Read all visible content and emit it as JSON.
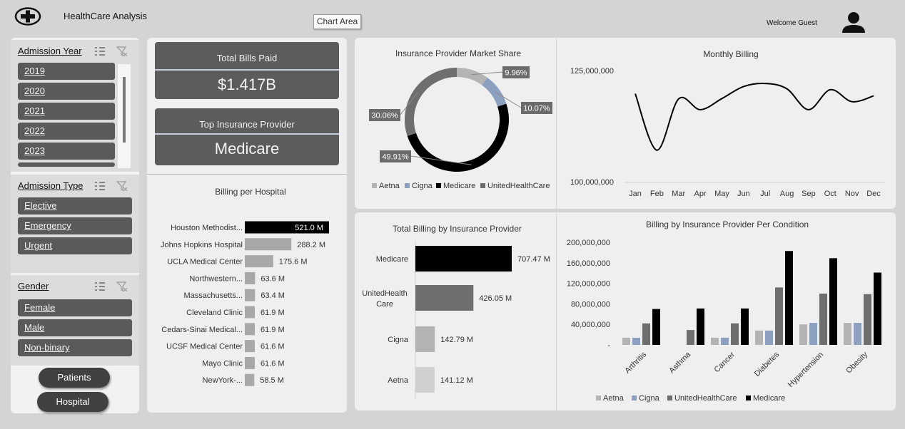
{
  "header": {
    "title": "HealthCare Analysis",
    "welcome": "Welcome Guest",
    "tooltip": "Chart Area"
  },
  "slicers": {
    "admission_year": {
      "title": "Admission Year",
      "items": [
        "2019",
        "2020",
        "2021",
        "2022",
        "2023"
      ]
    },
    "admission_type": {
      "title": "Admission Type",
      "items": [
        "Elective",
        "Emergency",
        "Urgent"
      ]
    },
    "gender": {
      "title": "Gender",
      "items": [
        "Female",
        "Male",
        "Non-binary"
      ]
    }
  },
  "nav": {
    "patients": "Patients",
    "hospital": "Hospital"
  },
  "kpis": {
    "total_bills_label": "Total Bills Paid",
    "total_bills_value": "$1.417B",
    "top_provider_label": "Top Insurance Provider",
    "top_provider_value": "Medicare"
  },
  "colors": {
    "aetna": "#b4b4b4",
    "cigna": "#8da0c0",
    "medicare": "#000000",
    "unitedhealthcare": "#6e6e6e"
  },
  "chart_data": [
    {
      "type": "bar",
      "title": "Billing per Hospital",
      "orientation": "horizontal",
      "categories": [
        "Houston Methodist...",
        "Johns Hopkins Hospital",
        "UCLA Medical Center",
        "Northwestern...",
        "Massachusetts...",
        "Cleveland Clinic",
        "Cedars-Sinai Medical...",
        "UCSF Medical Center",
        "Mayo Clinic",
        "NewYork-..."
      ],
      "values": [
        521.0,
        288.2,
        175.6,
        63.6,
        63.4,
        61.9,
        61.9,
        61.6,
        61.6,
        58.5
      ],
      "labels": [
        "521.0 M",
        "288.2 M",
        "175.6 M",
        "63.6 M",
        "63.4 M",
        "61.9 M",
        "61.9 M",
        "61.6 M",
        "61.6 M",
        "58.5 M"
      ]
    },
    {
      "type": "pie",
      "title": "Insurance Provider Market Share",
      "categories": [
        "Aetna",
        "Cigna",
        "Medicare",
        "UnitedHealthCare"
      ],
      "values": [
        9.96,
        10.07,
        49.91,
        30.06
      ],
      "labels": [
        "9.96%",
        "10.07%",
        "49.91%",
        "30.06%"
      ]
    },
    {
      "type": "line",
      "title": "Monthly Billing",
      "categories": [
        "Jan",
        "Feb",
        "Mar",
        "Apr",
        "May",
        "Jun",
        "Jul",
        "Aug",
        "Sep",
        "Oct",
        "Nov",
        "Dec"
      ],
      "values": [
        119800000,
        107100000,
        118600000,
        116200000,
        118700000,
        121400000,
        122100000,
        120900000,
        116200000,
        120700000,
        118000000,
        119300000
      ],
      "ylim": [
        100000000,
        125000000
      ],
      "yticks": [
        "125,000,000",
        "100,000,000"
      ]
    },
    {
      "type": "bar",
      "title": "Total Billing by Insurance Provider",
      "orientation": "horizontal",
      "categories": [
        "Medicare",
        "UnitedHealth Care",
        "Cigna",
        "Aetna"
      ],
      "values": [
        707.47,
        426.05,
        142.79,
        141.12
      ],
      "labels": [
        "707.47 M",
        "426.05 M",
        "142.79 M",
        "141.12 M"
      ]
    },
    {
      "type": "bar",
      "title": "Billing by Insurance Provider Per Condition",
      "categories": [
        "Arthritis",
        "Asthma",
        "Cancer",
        "Diabetes",
        "Hypertension",
        "Obesity"
      ],
      "ylim": [
        0,
        200000000
      ],
      "yticks": [
        "200,000,000",
        "160,000,000",
        "120,000,000",
        "80,000,000",
        "40,000,000",
        "-"
      ],
      "series": [
        {
          "name": "Aetna",
          "values": [
            14000000,
            0,
            14000000,
            28000000,
            40000000,
            43000000
          ]
        },
        {
          "name": "Cigna",
          "values": [
            14000000,
            0,
            14000000,
            28000000,
            43000000,
            43000000
          ]
        },
        {
          "name": "UnitedHealthCare",
          "values": [
            42000000,
            29000000,
            42000000,
            112000000,
            100000000,
            99000000
          ]
        },
        {
          "name": "Medicare",
          "values": [
            70000000,
            71000000,
            71000000,
            183000000,
            169000000,
            141000000
          ]
        }
      ]
    }
  ]
}
